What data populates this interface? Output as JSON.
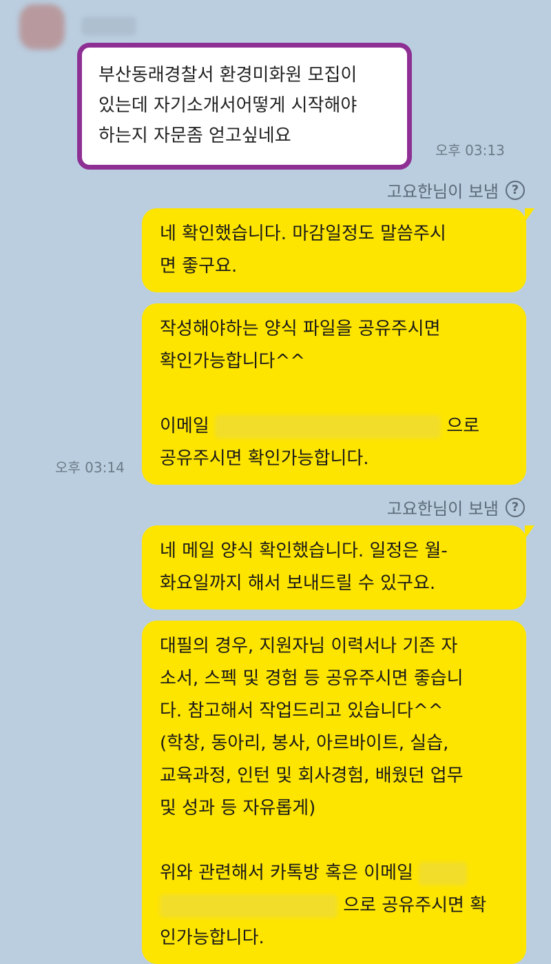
{
  "incoming": {
    "text": "부산동래경찰서 환경미화원 모집이\n있는데 자기소개서어떻게 시작해야\n하는지 자문좀 얻고싶네요",
    "time": "오후 03:13"
  },
  "sent_by_label_1": "고요한님이 보냄",
  "sent_by_label_2": "고요한님이 보냄",
  "help_symbol": "?",
  "bubbles": {
    "b1": "네 확인했습니다. 마감일정도 말씀주시\n면 좋구요.",
    "b2_p1": "작성해야하는 양식 파일을 공유주시면\n확인가능합니다^^",
    "b2_p2_before": "이메일",
    "b2_p2_after": "으로",
    "b2_p3": "공유주시면 확인가능합니다.",
    "b2_time": "오후 03:14",
    "b3": "네 메일 양식 확인했습니다. 일정은 월-\n화요일까지 해서 보내드릴 수 있구요.",
    "b4_p1": "대필의 경우, 지원자님 이력서나 기존 자\n소서, 스펙 및 경험 등 공유주시면 좋습니\n다. 참고해서 작업드리고 있습니다^^\n(학창, 동아리, 봉사, 아르바이트, 실습,\n교육과정, 인턴 및 회사경험, 배웠던 업무\n및 성과 등 자유롭게)",
    "b4_p2_before": "위와 관련해서 카톡방 혹은 이메일",
    "b4_p2_after": "으로 공유주시면 확",
    "b4_p3": "인가능합니다."
  },
  "colors": {
    "background": "#bacee0",
    "outgoing_bubble": "#fee500",
    "incoming_bubble": "#ffffff",
    "highlight_border": "#8e2f93"
  }
}
